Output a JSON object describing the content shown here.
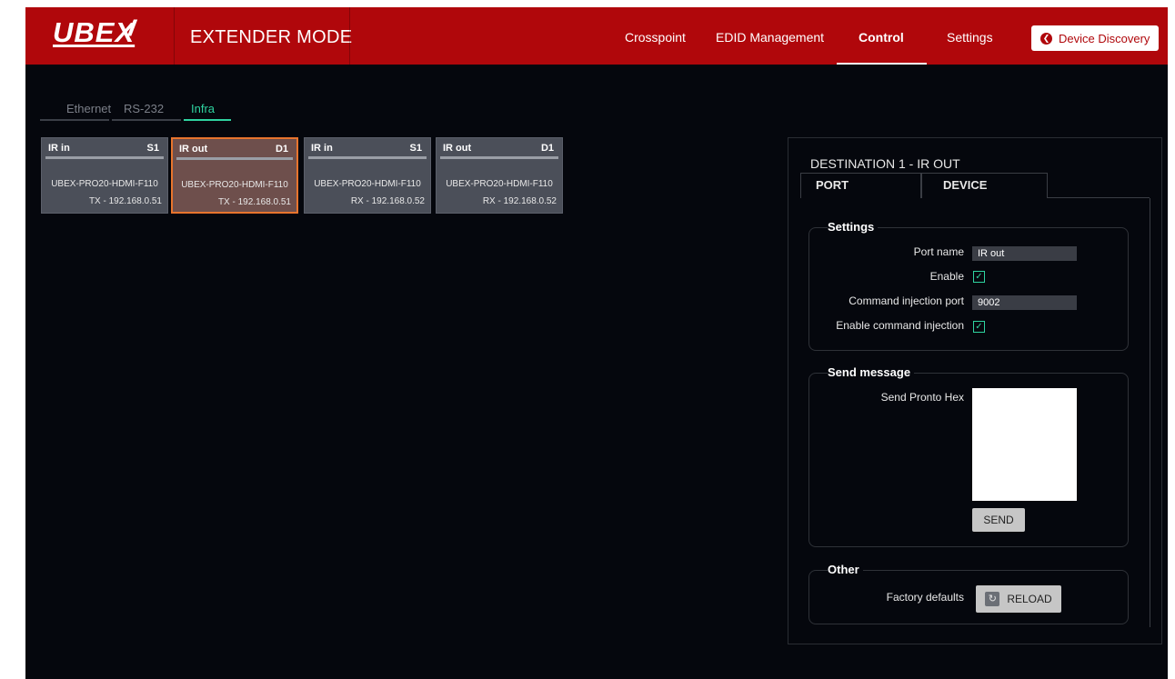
{
  "header": {
    "logo": "UBEX",
    "mode": "EXTENDER MODE",
    "nav": [
      "Crosspoint",
      "EDID Management",
      "Control",
      "Settings"
    ],
    "active_nav": "Control",
    "device_discovery": "Device Discovery",
    "brand_color": "#b0070b"
  },
  "subtabs": {
    "items": [
      "Ethernet",
      "RS-232",
      "Infra"
    ],
    "active": "Infra",
    "accent_color": "#2fd3a0"
  },
  "cards": [
    {
      "name": "IR in",
      "slot": "S1",
      "model": "UBEX-PRO20-HDMI-F110",
      "address": "TX - 192.168.0.51",
      "selected": false
    },
    {
      "name": "IR out",
      "slot": "D1",
      "model": "UBEX-PRO20-HDMI-F110",
      "address": "TX - 192.168.0.51",
      "selected": true
    },
    {
      "name": "IR in",
      "slot": "S1",
      "model": "UBEX-PRO20-HDMI-F110",
      "address": "RX - 192.168.0.52",
      "selected": false
    },
    {
      "name": "IR out",
      "slot": "D1",
      "model": "UBEX-PRO20-HDMI-F110",
      "address": "RX - 192.168.0.52",
      "selected": false
    }
  ],
  "panel": {
    "title": "DESTINATION 1 - IR OUT",
    "tabs": [
      "PORT",
      "DEVICE"
    ],
    "active_tab": "PORT",
    "settings": {
      "legend": "Settings",
      "port_name_label": "Port name",
      "port_name_value": "IR out",
      "enable_label": "Enable",
      "enable_checked": true,
      "cmd_port_label": "Command injection port",
      "cmd_port_value": "9002",
      "cmd_enable_label": "Enable command injection",
      "cmd_enable_checked": true
    },
    "send_message": {
      "legend": "Send message",
      "pronto_label": "Send Pronto Hex",
      "pronto_value": "",
      "send_button": "SEND"
    },
    "other": {
      "legend": "Other",
      "factory_label": "Factory defaults",
      "reload_button": "RELOAD"
    }
  }
}
